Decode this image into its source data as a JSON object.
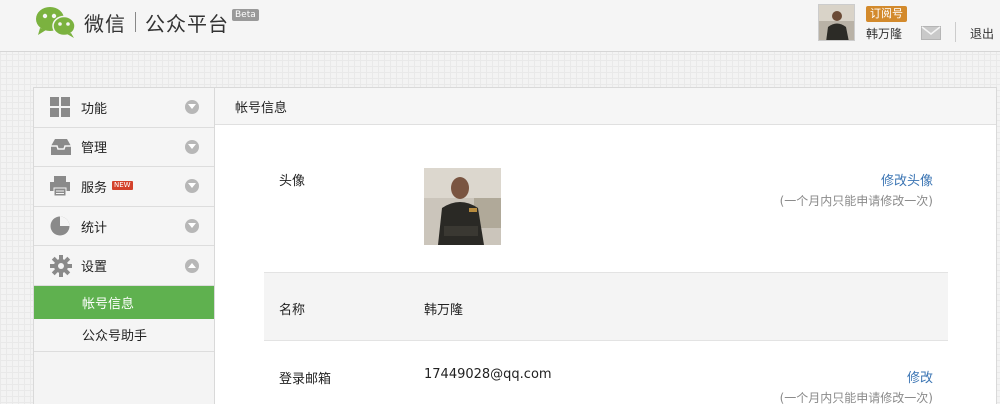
{
  "header": {
    "logo_text": "微信",
    "product_name": "公众平台",
    "beta_label": "Beta",
    "account_badge": "订阅号",
    "username": "韩万隆",
    "logout_label": "退出"
  },
  "sidebar": {
    "items": [
      {
        "label": "功能",
        "icon": "grid-icon",
        "expanded": false
      },
      {
        "label": "管理",
        "icon": "inbox-icon",
        "expanded": false
      },
      {
        "label": "服务",
        "icon": "printer-icon",
        "expanded": false,
        "badge": "NEW"
      },
      {
        "label": "统计",
        "icon": "pie-chart-icon",
        "expanded": false
      },
      {
        "label": "设置",
        "icon": "gear-icon",
        "expanded": true
      }
    ],
    "subitems": [
      {
        "label": "帐号信息",
        "active": true
      },
      {
        "label": "公众号助手",
        "active": false
      }
    ]
  },
  "main": {
    "title": "帐号信息",
    "rows": {
      "avatar": {
        "label": "头像",
        "action": "修改头像",
        "note": "(一个月内只能申请修改一次)"
      },
      "name": {
        "label": "名称",
        "value": "韩万隆"
      },
      "email": {
        "label": "登录邮箱",
        "value": "17449028@qq.com",
        "action": "修改",
        "note": "(一个月内只能申请修改一次)"
      }
    }
  },
  "colors": {
    "accent_green": "#5fb14f",
    "link_blue": "#3a74b3",
    "badge_orange": "#d38a2c",
    "new_red": "#d3412b"
  }
}
